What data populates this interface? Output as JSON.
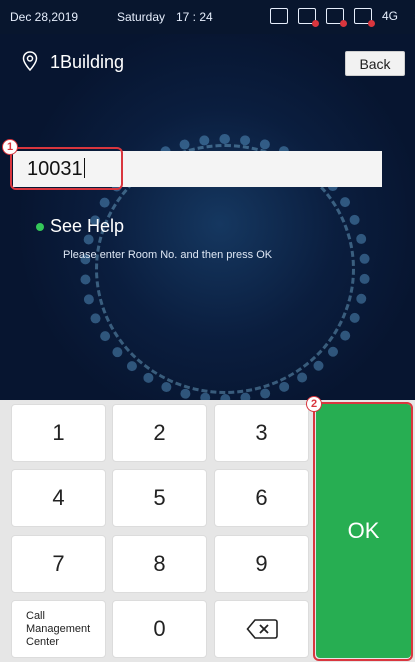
{
  "status_bar": {
    "date": "Dec 28,2019",
    "day": "Saturday",
    "time": "17 : 24",
    "network": "4G"
  },
  "header": {
    "building": "1Building",
    "back_label": "Back"
  },
  "input": {
    "value": "10031"
  },
  "help": {
    "see_help_label": "See Help",
    "hint_text": "Please enter Room No. and then press OK"
  },
  "annotations": {
    "marker_1": "1",
    "marker_2": "2"
  },
  "keypad": {
    "keys": [
      "1",
      "2",
      "3",
      "4",
      "5",
      "6",
      "7",
      "8",
      "9",
      "0"
    ],
    "call_center_label": "Call Management Center",
    "ok_label": "OK"
  },
  "colors": {
    "ok_green": "#27ae52",
    "highlight_red": "#d9363e",
    "background_navy": "#0b1a33"
  }
}
